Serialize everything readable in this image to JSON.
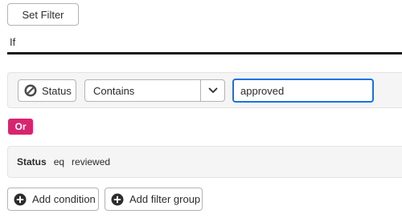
{
  "toolbar": {
    "set_filter_label": "Set Filter"
  },
  "filter": {
    "if_label": "If",
    "condition": {
      "field_label": "Status",
      "field_icon": "no-entry-icon",
      "operator_value": "Contains",
      "operator_icon": "chevron-down-icon",
      "value": "approved"
    },
    "group_connector": {
      "label": "Or",
      "color": "#d8246f"
    },
    "summary": {
      "field": "Status",
      "operator": "eq",
      "value": "reviewed"
    }
  },
  "actions": {
    "add_condition_label": "Add condition",
    "add_filter_group_label": "Add filter group",
    "icon": "plus-circle-icon"
  },
  "colors": {
    "focus_border": "#1473e6",
    "card_background": "#f5f5f5",
    "divider": "#1a1a1a"
  }
}
